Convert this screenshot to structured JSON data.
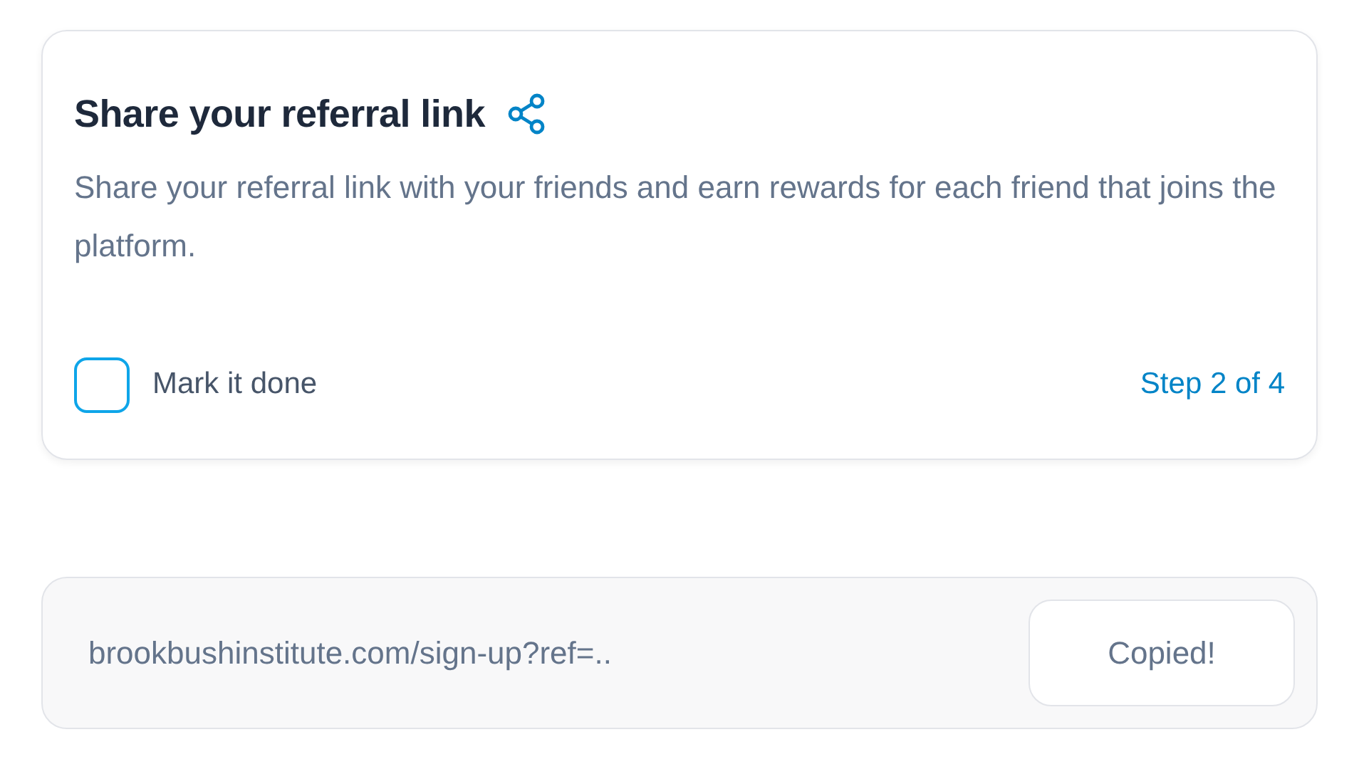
{
  "task_card": {
    "title": "Share your referral link",
    "description": "Share your referral link with your friends and earn rewards for each friend that joins the platform.",
    "done_checkbox": {
      "label": "Mark it done",
      "checked": false
    },
    "step": "Step 2 of 4"
  },
  "link_box": {
    "url": "brookbushinstitute.com/sign-up?ref=..",
    "copy_button": "Copied!"
  }
}
